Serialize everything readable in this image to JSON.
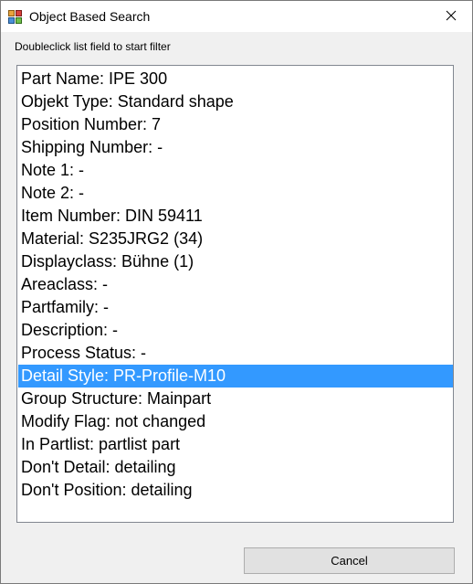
{
  "window": {
    "title": "Object Based Search",
    "icon": "app-icon"
  },
  "instruction": "Doubleclick list field to start filter",
  "list": {
    "selected_index": 13,
    "items": [
      "Part Name:   IPE 300",
      "Objekt Type:   Standard shape",
      "Position Number:   7",
      "Shipping Number:   -",
      "Note 1:   -",
      "Note 2:   -",
      "Item Number:   DIN 59411",
      "Material:   S235JRG2 (34)",
      "Displayclass:   Bühne (1)",
      "Areaclass:   -",
      "Partfamily:   -",
      "Description:   -",
      "Process Status:   -",
      "Detail Style:   PR-Profile-M10",
      "Group Structure:   Mainpart",
      "Modify Flag:   not changed",
      "In Partlist:   partlist part",
      "Don't Detail:   detailing",
      "Don't Position:   detailing"
    ]
  },
  "buttons": {
    "cancel": "Cancel"
  },
  "colors": {
    "selection": "#3399ff",
    "dialog_background": "#f0f0f0",
    "button_background": "#e1e1e1"
  }
}
